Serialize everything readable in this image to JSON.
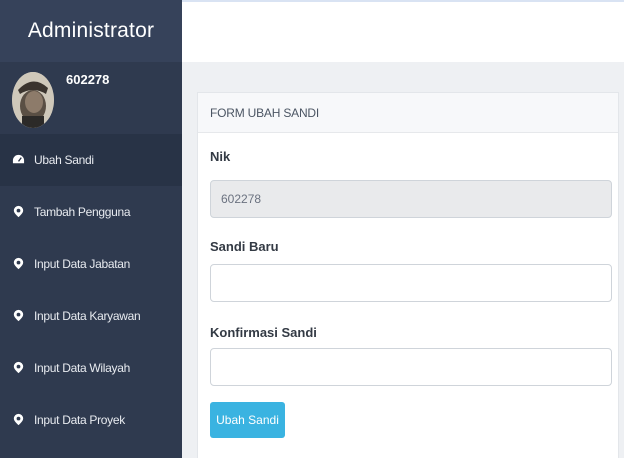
{
  "sidebar": {
    "brand": "Administrator",
    "user_id": "602278",
    "items": [
      {
        "label": "Ubah Sandi",
        "icon": "dashboard-icon",
        "active": true
      },
      {
        "label": "Tambah Pengguna",
        "icon": "location-pin-icon",
        "active": false
      },
      {
        "label": "Input Data Jabatan",
        "icon": "location-pin-icon",
        "active": false
      },
      {
        "label": "Input Data Karyawan",
        "icon": "location-pin-icon",
        "active": false
      },
      {
        "label": "Input Data Wilayah",
        "icon": "location-pin-icon",
        "active": false
      },
      {
        "label": "Input Data Proyek",
        "icon": "location-pin-icon",
        "active": false
      }
    ]
  },
  "form": {
    "title": "FORM UBAH SANDI",
    "nik_label": "Nik",
    "nik_value": "602278",
    "sandi_baru_label": "Sandi Baru",
    "sandi_baru_value": "",
    "konfirmasi_label": "Konfirmasi Sandi",
    "konfirmasi_value": "",
    "submit_label": "Ubah Sandi"
  },
  "colors": {
    "sidebar_bg": "#2f3a4f",
    "brand_bg": "#36425a",
    "active_item_bg": "#283346",
    "button_bg": "#3ab3e1"
  }
}
